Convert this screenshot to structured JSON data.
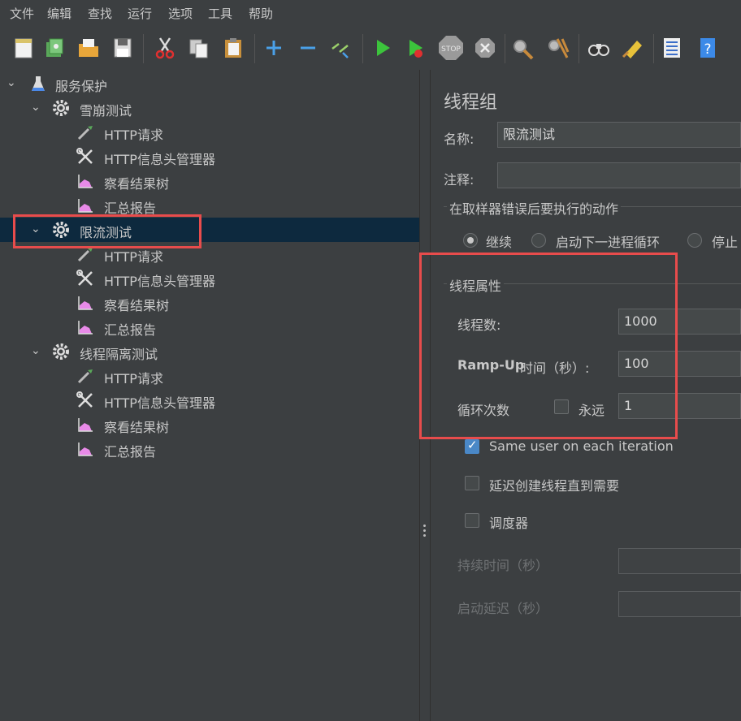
{
  "menu": [
    "文件",
    "编辑",
    "查找",
    "运行",
    "选项",
    "工具",
    "帮助"
  ],
  "toolbar_icons": [
    "new-icon",
    "templates-icon",
    "open-icon",
    "save-icon",
    "cut-icon",
    "copy-icon",
    "paste-icon",
    "expand-icon",
    "collapse-icon",
    "toggle-icon",
    "start-icon",
    "start-no-timers-icon",
    "stop-icon",
    "shutdown-icon",
    "clear-icon",
    "clear-all-icon",
    "search-icon",
    "reset-search-icon",
    "function-helper-icon",
    "help-icon"
  ],
  "stop_label": "STOP",
  "tree": {
    "root": "服务保护",
    "groups": [
      {
        "label": "雪崩测试",
        "children": [
          "HTTP请求",
          "HTTP信息头管理器",
          "察看结果树",
          "汇总报告"
        ]
      },
      {
        "label": "限流测试",
        "children": [
          "HTTP请求",
          "HTTP信息头管理器",
          "察看结果树",
          "汇总报告"
        ]
      },
      {
        "label": "线程隔离测试",
        "children": [
          "HTTP请求",
          "HTTP信息头管理器",
          "察看结果树",
          "汇总报告"
        ]
      }
    ],
    "selected": "限流测试"
  },
  "panel": {
    "title": "线程组",
    "name_label": "名称:",
    "name_value": "限流测试",
    "comment_label": "注释:",
    "comment_value": "",
    "error_group_title": "在取样器错误后要执行的动作",
    "error_options": [
      "继续",
      "启动下一进程循环",
      "停止"
    ],
    "error_selected": "继续",
    "thread_group_title": "线程属性",
    "threads_label": "线程数:",
    "threads_value": "1000",
    "rampup_label_en": "Ramp-Up",
    "rampup_label_cn": "时间（秒）:",
    "rampup_value": "100",
    "loop_label": "循环次数",
    "forever_label": "永远",
    "forever_checked": false,
    "loop_value": "1",
    "same_user_label": "Same user on each iteration",
    "same_user_checked": true,
    "delay_label": "延迟创建线程直到需要",
    "delay_checked": false,
    "scheduler_label": "调度器",
    "scheduler_checked": false,
    "duration_label": "持续时间（秒）",
    "duration_value": "",
    "startup_delay_label": "启动延迟（秒）",
    "startup_delay_value": ""
  },
  "colors": {
    "highlight": "#e84c4c",
    "selected_row": "#0d293e",
    "background": "#3c3f41"
  }
}
